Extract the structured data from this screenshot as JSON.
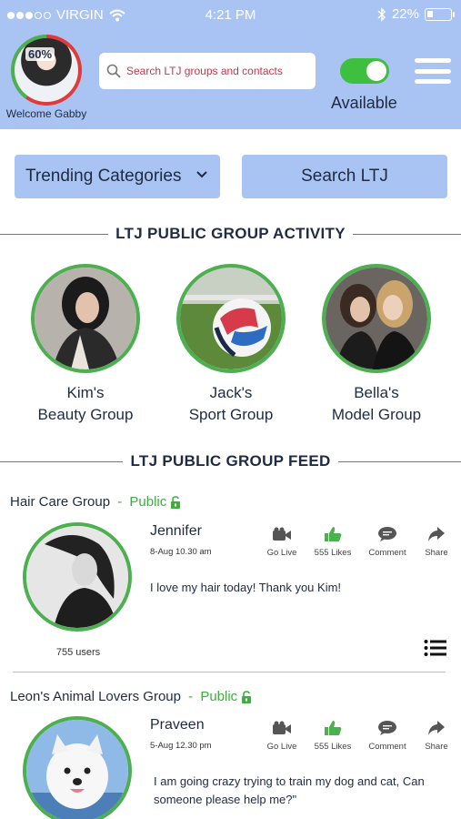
{
  "status_bar": {
    "carrier": "VIRGIN",
    "time": "4:21 PM",
    "battery": "22%"
  },
  "header": {
    "profile_percent": "60%",
    "welcome": "Welcome Gabby",
    "search_placeholder": "Search LTJ groups and contacts",
    "availability": "Available",
    "availability_on": true
  },
  "actions": {
    "trending": "Trending Categories",
    "search": "Search LTJ"
  },
  "activity": {
    "title": "LTJ PUBLIC GROUP ACTIVITY",
    "groups": [
      {
        "line1": "Kim's",
        "line2": "Beauty Group",
        "image": "woman-portrait"
      },
      {
        "line1": "Jack's",
        "line2": "Sport Group",
        "image": "soccer-ball"
      },
      {
        "line1": "Bella's",
        "line2": "Model Group",
        "image": "two-women"
      }
    ]
  },
  "feed": {
    "title": "LTJ PUBLIC GROUP FEED",
    "posts": [
      {
        "group": "Hair Care Group",
        "separator": " - ",
        "visibility": "Public",
        "author": "Jennifer",
        "date": "8-Aug 10.30 am",
        "go_live": "Go Live",
        "likes": "555 Likes",
        "comment": "Comment",
        "share": "Share",
        "message": "I love my hair today! Thank you Kim!",
        "users": "755 users"
      },
      {
        "group": "Leon's Animal Lovers Group",
        "separator": " - ",
        "visibility": "Public",
        "author": "Praveen",
        "date": "5-Aug 12.30 pm",
        "go_live": "Go Live",
        "likes": "555 Likes",
        "comment": "Comment",
        "share": "Share",
        "message": "I am going crazy trying to train my dog and cat, Can someone please help me?\""
      }
    ]
  },
  "colors": {
    "header_bg": "#a9c4f3",
    "accent_green": "#4caf50",
    "public_green": "#3fae3f",
    "search_text": "#c0394a",
    "progress_red": "#e03a3a"
  }
}
